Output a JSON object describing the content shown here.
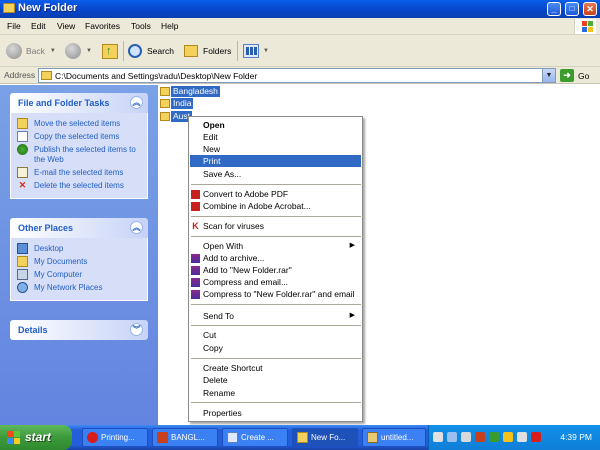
{
  "window": {
    "title": "New Folder",
    "controls": {
      "minimize": "_",
      "maximize": "□",
      "close": "✕"
    }
  },
  "menubar": [
    "File",
    "Edit",
    "View",
    "Favorites",
    "Tools",
    "Help"
  ],
  "toolbar": {
    "back": "Back",
    "search": "Search",
    "folders": "Folders"
  },
  "address": {
    "label": "Address",
    "value": "C:\\Documents and Settings\\radu\\Desktop\\New Folder",
    "go": "Go"
  },
  "task_pane": {
    "file_tasks": {
      "title": "File and Folder Tasks",
      "items": [
        {
          "label": "Move the selected items",
          "icon": "move-icon"
        },
        {
          "label": "Copy the selected items",
          "icon": "copy-icon"
        },
        {
          "label": "Publish the selected items to the Web",
          "icon": "globe-icon"
        },
        {
          "label": "E-mail the selected items",
          "icon": "email-icon"
        },
        {
          "label": "Delete the selected items",
          "icon": "delete-icon"
        }
      ]
    },
    "other_places": {
      "title": "Other Places",
      "items": [
        {
          "label": "Desktop",
          "icon": "desktop-icon"
        },
        {
          "label": "My Documents",
          "icon": "my-documents-icon"
        },
        {
          "label": "My Computer",
          "icon": "my-computer-icon"
        },
        {
          "label": "My Network Places",
          "icon": "network-places-icon"
        }
      ]
    },
    "details": {
      "title": "Details"
    }
  },
  "files": [
    {
      "name": "Bangladesh"
    },
    {
      "name": "India"
    },
    {
      "name": "Aust"
    }
  ],
  "context_menu": {
    "items": [
      {
        "label": "Open",
        "bold": true
      },
      {
        "label": "Edit"
      },
      {
        "label": "New"
      },
      {
        "label": "Print",
        "highlighted": true
      },
      {
        "label": "Save As..."
      },
      {
        "label": "Convert to Adobe PDF",
        "icon": "adobe-pdf-icon"
      },
      {
        "label": "Combine in Adobe Acrobat...",
        "icon": "adobe-acrobat-icon"
      },
      {
        "label": "Scan for viruses",
        "icon": "antivirus-icon"
      },
      {
        "label": "Open With",
        "submenu": true
      },
      {
        "label": "Add to archive...",
        "icon": "winrar-icon"
      },
      {
        "label": "Add to \"New Folder.rar\"",
        "icon": "winrar-icon"
      },
      {
        "label": "Compress and email...",
        "icon": "winrar-icon"
      },
      {
        "label": "Compress to \"New Folder.rar\" and email",
        "icon": "winrar-icon"
      },
      {
        "label": "Send To",
        "submenu": true
      },
      {
        "label": "Cut"
      },
      {
        "label": "Copy"
      },
      {
        "label": "Create Shortcut"
      },
      {
        "label": "Delete"
      },
      {
        "label": "Rename"
      },
      {
        "label": "Properties"
      }
    ]
  },
  "taskbar": {
    "start": "start",
    "buttons": [
      {
        "label": "Printing...",
        "icon": "opera-icon"
      },
      {
        "label": "BANGL...",
        "icon": "presentation-icon"
      },
      {
        "label": "Create ...",
        "icon": "window-icon"
      },
      {
        "label": "New Fo...",
        "icon": "folder-icon",
        "active": true
      },
      {
        "label": "untitled...",
        "icon": "paint-icon"
      }
    ],
    "clock": "4:39 PM"
  }
}
